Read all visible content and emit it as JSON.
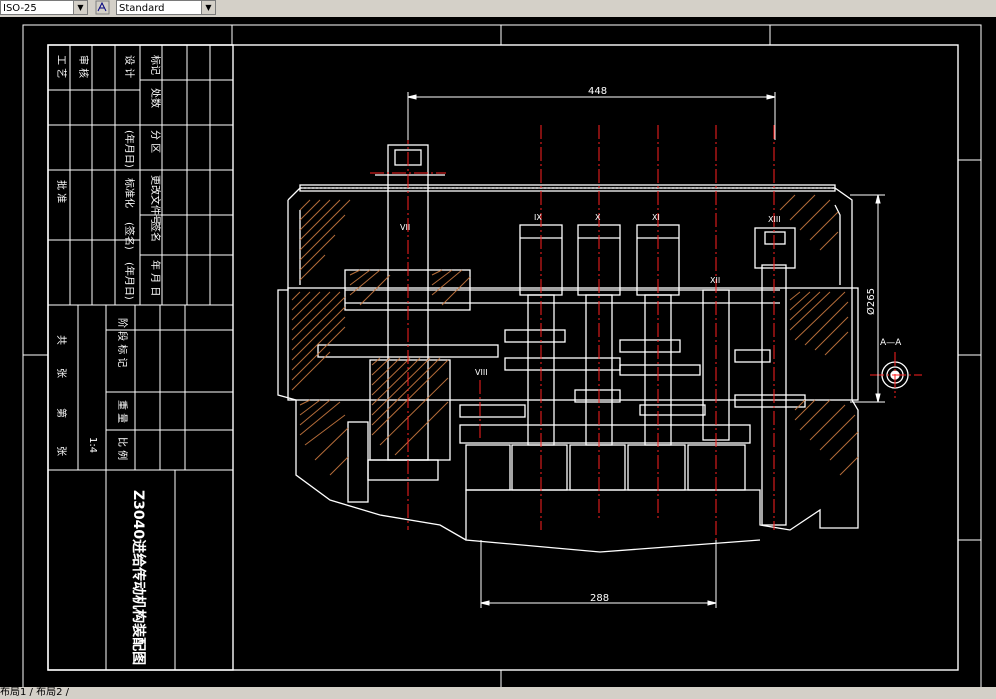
{
  "toolbar": {
    "dimstyle_value": "ISO-25",
    "textstyle_value": "Standard",
    "textstyle_icon": "text-style-icon"
  },
  "title_block": {
    "rows_left": [
      "标记",
      "处数",
      "分 区",
      "更改文件号",
      "签名",
      "年 月 日"
    ],
    "rows_design": [
      "设 计",
      "(签名)",
      "(年月日)",
      "标准化",
      "(签名)",
      "(年月日)"
    ],
    "rows_review": [
      "审 核"
    ],
    "rows_process": [
      "工 艺"
    ],
    "approve": "批 准",
    "stage_labels": [
      "阶 段 标 记",
      "重 量",
      "比 例"
    ],
    "scale_value": "1:4",
    "sheet_labels": [
      "共",
      "张",
      "第",
      "张"
    ],
    "drawing_title": "Z3040进给传动机构装配图"
  },
  "drawing": {
    "dim_top": "448",
    "dim_bottom": "288",
    "dim_right": "Ø265",
    "section_label": "A—A",
    "shaft_labels": [
      "VII",
      "VIII",
      "IX",
      "X",
      "XI",
      "XII",
      "XIII"
    ]
  },
  "status": {
    "tab_text": "布局1 / 布局2 /"
  }
}
